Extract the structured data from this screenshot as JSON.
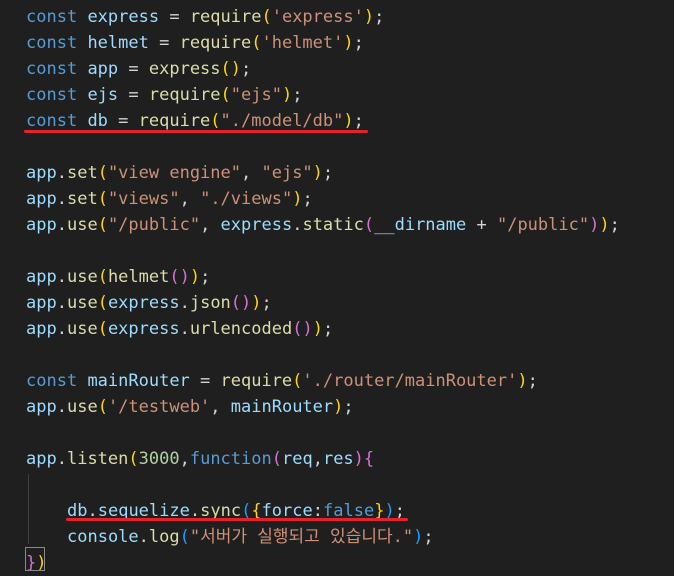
{
  "code": {
    "lines": [
      {
        "tokens": [
          [
            "kw",
            "const"
          ],
          [
            "pun",
            " "
          ],
          [
            "var",
            "express"
          ],
          [
            "pun",
            " = "
          ],
          [
            "fn",
            "require"
          ],
          [
            "br1",
            "("
          ],
          [
            "str",
            "'express'"
          ],
          [
            "br1",
            ")"
          ],
          [
            "pun",
            ";"
          ]
        ]
      },
      {
        "tokens": [
          [
            "kw",
            "const"
          ],
          [
            "pun",
            " "
          ],
          [
            "var",
            "helmet"
          ],
          [
            "pun",
            " = "
          ],
          [
            "fn",
            "require"
          ],
          [
            "br1",
            "("
          ],
          [
            "str",
            "'helmet'"
          ],
          [
            "br1",
            ")"
          ],
          [
            "pun",
            ";"
          ]
        ]
      },
      {
        "tokens": [
          [
            "kw",
            "const"
          ],
          [
            "pun",
            " "
          ],
          [
            "var",
            "app"
          ],
          [
            "pun",
            " = "
          ],
          [
            "fn",
            "express"
          ],
          [
            "br1",
            "()"
          ],
          [
            "pun",
            ";"
          ]
        ]
      },
      {
        "tokens": [
          [
            "kw",
            "const"
          ],
          [
            "pun",
            " "
          ],
          [
            "var",
            "ejs"
          ],
          [
            "pun",
            " = "
          ],
          [
            "fn",
            "require"
          ],
          [
            "br1",
            "("
          ],
          [
            "str",
            "\"ejs\""
          ],
          [
            "br1",
            ")"
          ],
          [
            "pun",
            ";"
          ]
        ]
      },
      {
        "tokens": [
          [
            "kw",
            "const"
          ],
          [
            "pun",
            " "
          ],
          [
            "var",
            "db"
          ],
          [
            "pun",
            " = "
          ],
          [
            "fn",
            "require"
          ],
          [
            "br1",
            "("
          ],
          [
            "str",
            "\"./model/db\""
          ],
          [
            "br1",
            ")"
          ],
          [
            "pun",
            ";"
          ]
        ]
      },
      {
        "tokens": []
      },
      {
        "tokens": [
          [
            "var",
            "app"
          ],
          [
            "pun",
            "."
          ],
          [
            "fn",
            "set"
          ],
          [
            "br1",
            "("
          ],
          [
            "str",
            "\"view engine\""
          ],
          [
            "pun",
            ", "
          ],
          [
            "str",
            "\"ejs\""
          ],
          [
            "br1",
            ")"
          ],
          [
            "pun",
            ";"
          ]
        ]
      },
      {
        "tokens": [
          [
            "var",
            "app"
          ],
          [
            "pun",
            "."
          ],
          [
            "fn",
            "set"
          ],
          [
            "br1",
            "("
          ],
          [
            "str",
            "\"views\""
          ],
          [
            "pun",
            ", "
          ],
          [
            "str",
            "\"./views\""
          ],
          [
            "br1",
            ")"
          ],
          [
            "pun",
            ";"
          ]
        ]
      },
      {
        "tokens": [
          [
            "var",
            "app"
          ],
          [
            "pun",
            "."
          ],
          [
            "fn",
            "use"
          ],
          [
            "br1",
            "("
          ],
          [
            "str",
            "\"/public\""
          ],
          [
            "pun",
            ", "
          ],
          [
            "var",
            "express"
          ],
          [
            "pun",
            "."
          ],
          [
            "fn",
            "static"
          ],
          [
            "br2",
            "("
          ],
          [
            "var",
            "__dirname"
          ],
          [
            "pun",
            " + "
          ],
          [
            "str",
            "\"/public\""
          ],
          [
            "br2",
            ")"
          ],
          [
            "br1",
            ")"
          ],
          [
            "pun",
            ";"
          ]
        ]
      },
      {
        "tokens": []
      },
      {
        "tokens": [
          [
            "var",
            "app"
          ],
          [
            "pun",
            "."
          ],
          [
            "fn",
            "use"
          ],
          [
            "br1",
            "("
          ],
          [
            "fn",
            "helmet"
          ],
          [
            "br2",
            "()"
          ],
          [
            "br1",
            ")"
          ],
          [
            "pun",
            ";"
          ]
        ]
      },
      {
        "tokens": [
          [
            "var",
            "app"
          ],
          [
            "pun",
            "."
          ],
          [
            "fn",
            "use"
          ],
          [
            "br1",
            "("
          ],
          [
            "var",
            "express"
          ],
          [
            "pun",
            "."
          ],
          [
            "fn",
            "json"
          ],
          [
            "br2",
            "()"
          ],
          [
            "br1",
            ")"
          ],
          [
            "pun",
            ";"
          ]
        ]
      },
      {
        "tokens": [
          [
            "var",
            "app"
          ],
          [
            "pun",
            "."
          ],
          [
            "fn",
            "use"
          ],
          [
            "br1",
            "("
          ],
          [
            "var",
            "express"
          ],
          [
            "pun",
            "."
          ],
          [
            "fn",
            "urlencoded"
          ],
          [
            "br2",
            "()"
          ],
          [
            "br1",
            ")"
          ],
          [
            "pun",
            ";"
          ]
        ]
      },
      {
        "tokens": []
      },
      {
        "tokens": [
          [
            "kw",
            "const"
          ],
          [
            "pun",
            " "
          ],
          [
            "var",
            "mainRouter"
          ],
          [
            "pun",
            " = "
          ],
          [
            "fn",
            "require"
          ],
          [
            "br1",
            "("
          ],
          [
            "str",
            "'./router/mainRouter'"
          ],
          [
            "br1",
            ")"
          ],
          [
            "pun",
            ";"
          ]
        ]
      },
      {
        "tokens": [
          [
            "var",
            "app"
          ],
          [
            "pun",
            "."
          ],
          [
            "fn",
            "use"
          ],
          [
            "br1",
            "("
          ],
          [
            "str",
            "'/testweb'"
          ],
          [
            "pun",
            ", "
          ],
          [
            "var",
            "mainRouter"
          ],
          [
            "br1",
            ")"
          ],
          [
            "pun",
            ";"
          ]
        ]
      },
      {
        "tokens": []
      },
      {
        "tokens": [
          [
            "var",
            "app"
          ],
          [
            "pun",
            "."
          ],
          [
            "fn",
            "listen"
          ],
          [
            "br1",
            "("
          ],
          [
            "num",
            "3000"
          ],
          [
            "pun",
            ","
          ],
          [
            "kw",
            "function"
          ],
          [
            "br2",
            "("
          ],
          [
            "var",
            "req"
          ],
          [
            "pun",
            ","
          ],
          [
            "var",
            "res"
          ],
          [
            "br2",
            ")"
          ],
          [
            "br2",
            "{"
          ]
        ]
      },
      {
        "tokens": []
      },
      {
        "indent": true,
        "tokens": [
          [
            "var",
            "db"
          ],
          [
            "pun",
            "."
          ],
          [
            "var",
            "sequelize"
          ],
          [
            "pun",
            "."
          ],
          [
            "fn",
            "sync"
          ],
          [
            "br3",
            "("
          ],
          [
            "br1",
            "{"
          ],
          [
            "var",
            "force"
          ],
          [
            "pun",
            ":"
          ],
          [
            "bool",
            "false"
          ],
          [
            "br1",
            "}"
          ],
          [
            "br3",
            ")"
          ],
          [
            "pun",
            ";"
          ]
        ]
      },
      {
        "indent": true,
        "tokens": [
          [
            "var",
            "console"
          ],
          [
            "pun",
            "."
          ],
          [
            "fn",
            "log"
          ],
          [
            "br3",
            "("
          ],
          [
            "str",
            "\"서버가 실행되고 있습니다.\""
          ],
          [
            "br3",
            ")"
          ],
          [
            "pun",
            ";"
          ]
        ]
      },
      {
        "tokens": [
          [
            "br2",
            "}"
          ],
          [
            "br1",
            ")"
          ]
        ]
      }
    ]
  }
}
